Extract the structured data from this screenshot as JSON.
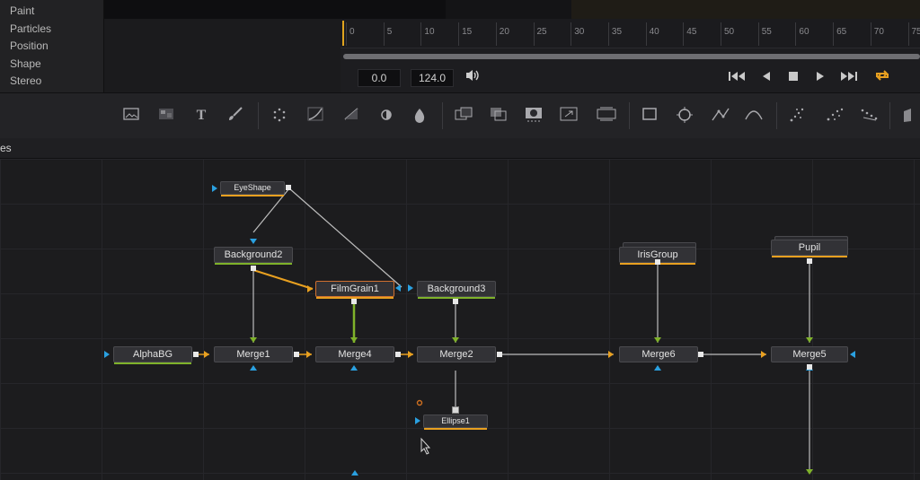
{
  "tool_list": {
    "items": [
      "Paint",
      "Particles",
      "Position",
      "Shape",
      "Stereo"
    ]
  },
  "timeline": {
    "ticks": [
      "0",
      "5",
      "10",
      "15",
      "20",
      "25",
      "30",
      "35",
      "40",
      "45",
      "50",
      "55",
      "60",
      "65",
      "70",
      "75"
    ],
    "current_time": "0.0",
    "end_time": "124.0"
  },
  "transport": {
    "volume_icon": "speaker-icon",
    "buttons": [
      "skip-to-start-icon",
      "play-reverse-icon",
      "stop-icon",
      "play-icon",
      "skip-to-end-icon",
      "loop-icon"
    ],
    "loop_color": "#e8a020"
  },
  "toolbar": {
    "icons": [
      "background-icon",
      "fastnoise-icon",
      "text-icon",
      "paint-icon",
      "particles-icon",
      "color-curves-icon",
      "brightness-contrast-icon",
      "color-corrector-icon",
      "blur-icon",
      "merge-icon",
      "channel-booleans-icon",
      "matte-control-icon",
      "transform-icon",
      "resize-icon",
      "rectangle-icon",
      "ellipse-icon",
      "polygon-icon",
      "bspline-icon",
      "pemitter-icon",
      "prender-icon",
      "pdirectional-icon",
      "3d-icon"
    ]
  },
  "nodes_panel": {
    "title": "es"
  },
  "nodes": {
    "eyeshape": "EyeShape",
    "background2": "Background2",
    "filmgrain1": "FilmGrain1",
    "background3": "Background3",
    "irisgroup": "IrisGroup",
    "pupil": "Pupil",
    "alphabg": "AlphaBG",
    "merge1": "Merge1",
    "merge4": "Merge4",
    "merge2": "Merge2",
    "merge6": "Merge6",
    "merge5": "Merge5",
    "ellipse1": "Ellipse1"
  },
  "colors": {
    "accent": "#e8a020",
    "green": "#7fb22a",
    "blue": "#2aa0e0",
    "gray_wire": "#c8c8c8"
  }
}
